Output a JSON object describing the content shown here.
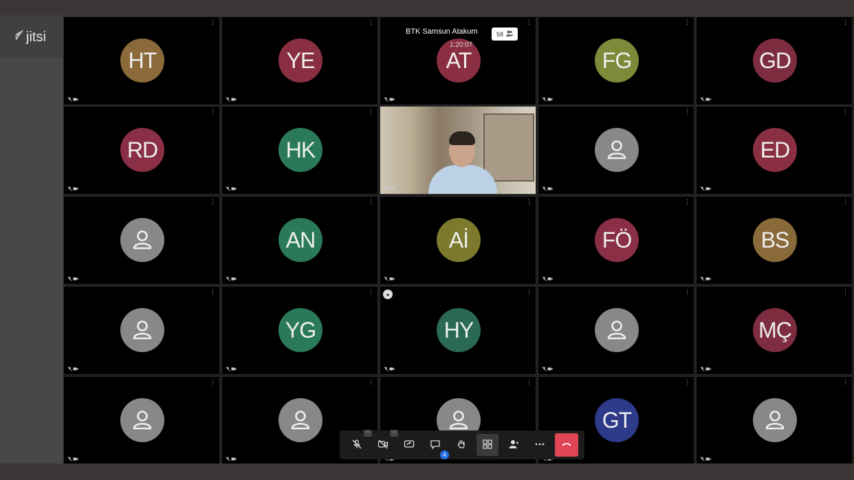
{
  "app": {
    "logo_text": "jitsi"
  },
  "meeting": {
    "title": "BTK Samsun Atakum",
    "timer": "1:20:07",
    "participant_count": "58"
  },
  "tiles": [
    {
      "initials": "HT",
      "color": "#8b6a3a"
    },
    {
      "initials": "YE",
      "color": "#8a2f42"
    },
    {
      "initials": "AT",
      "color": "#8a2f42"
    },
    {
      "initials": "FG",
      "color": "#7c8a3a"
    },
    {
      "initials": "GD",
      "color": "#7d2d3f"
    },
    {
      "initials": "RD",
      "color": "#8a2f46"
    },
    {
      "initials": "HK",
      "color": "#2a7a5a"
    },
    {
      "initials": "",
      "video": true
    },
    {
      "initials": "",
      "placeholder": true
    },
    {
      "initials": "ED",
      "color": "#8a2f42"
    },
    {
      "initials": "",
      "placeholder": true
    },
    {
      "initials": "AN",
      "color": "#2a7a5a"
    },
    {
      "initials": "Aİ",
      "color": "#7d7a2e"
    },
    {
      "initials": "FÖ",
      "color": "#8a2f46"
    },
    {
      "initials": "BS",
      "color": "#8b6a3a"
    },
    {
      "initials": "",
      "placeholder": true
    },
    {
      "initials": "YG",
      "color": "#2a7a5a"
    },
    {
      "initials": "HY",
      "color": "#2a6a55"
    },
    {
      "initials": "",
      "placeholder": true
    },
    {
      "initials": "MÇ",
      "color": "#7d2d3f"
    },
    {
      "initials": "",
      "placeholder": true
    },
    {
      "initials": "",
      "placeholder": true
    },
    {
      "initials": "",
      "placeholder": true
    },
    {
      "initials": "GT",
      "color": "#2e3a8a"
    },
    {
      "initials": "",
      "placeholder": true
    }
  ],
  "toolbar": {
    "chat_unread": "4",
    "buttons": [
      "mic-muted-icon",
      "camera-off-icon",
      "screen-share-icon",
      "chat-icon",
      "raise-hand-icon",
      "tile-view-icon",
      "invite-icon",
      "more-icon",
      "hangup-icon"
    ]
  }
}
